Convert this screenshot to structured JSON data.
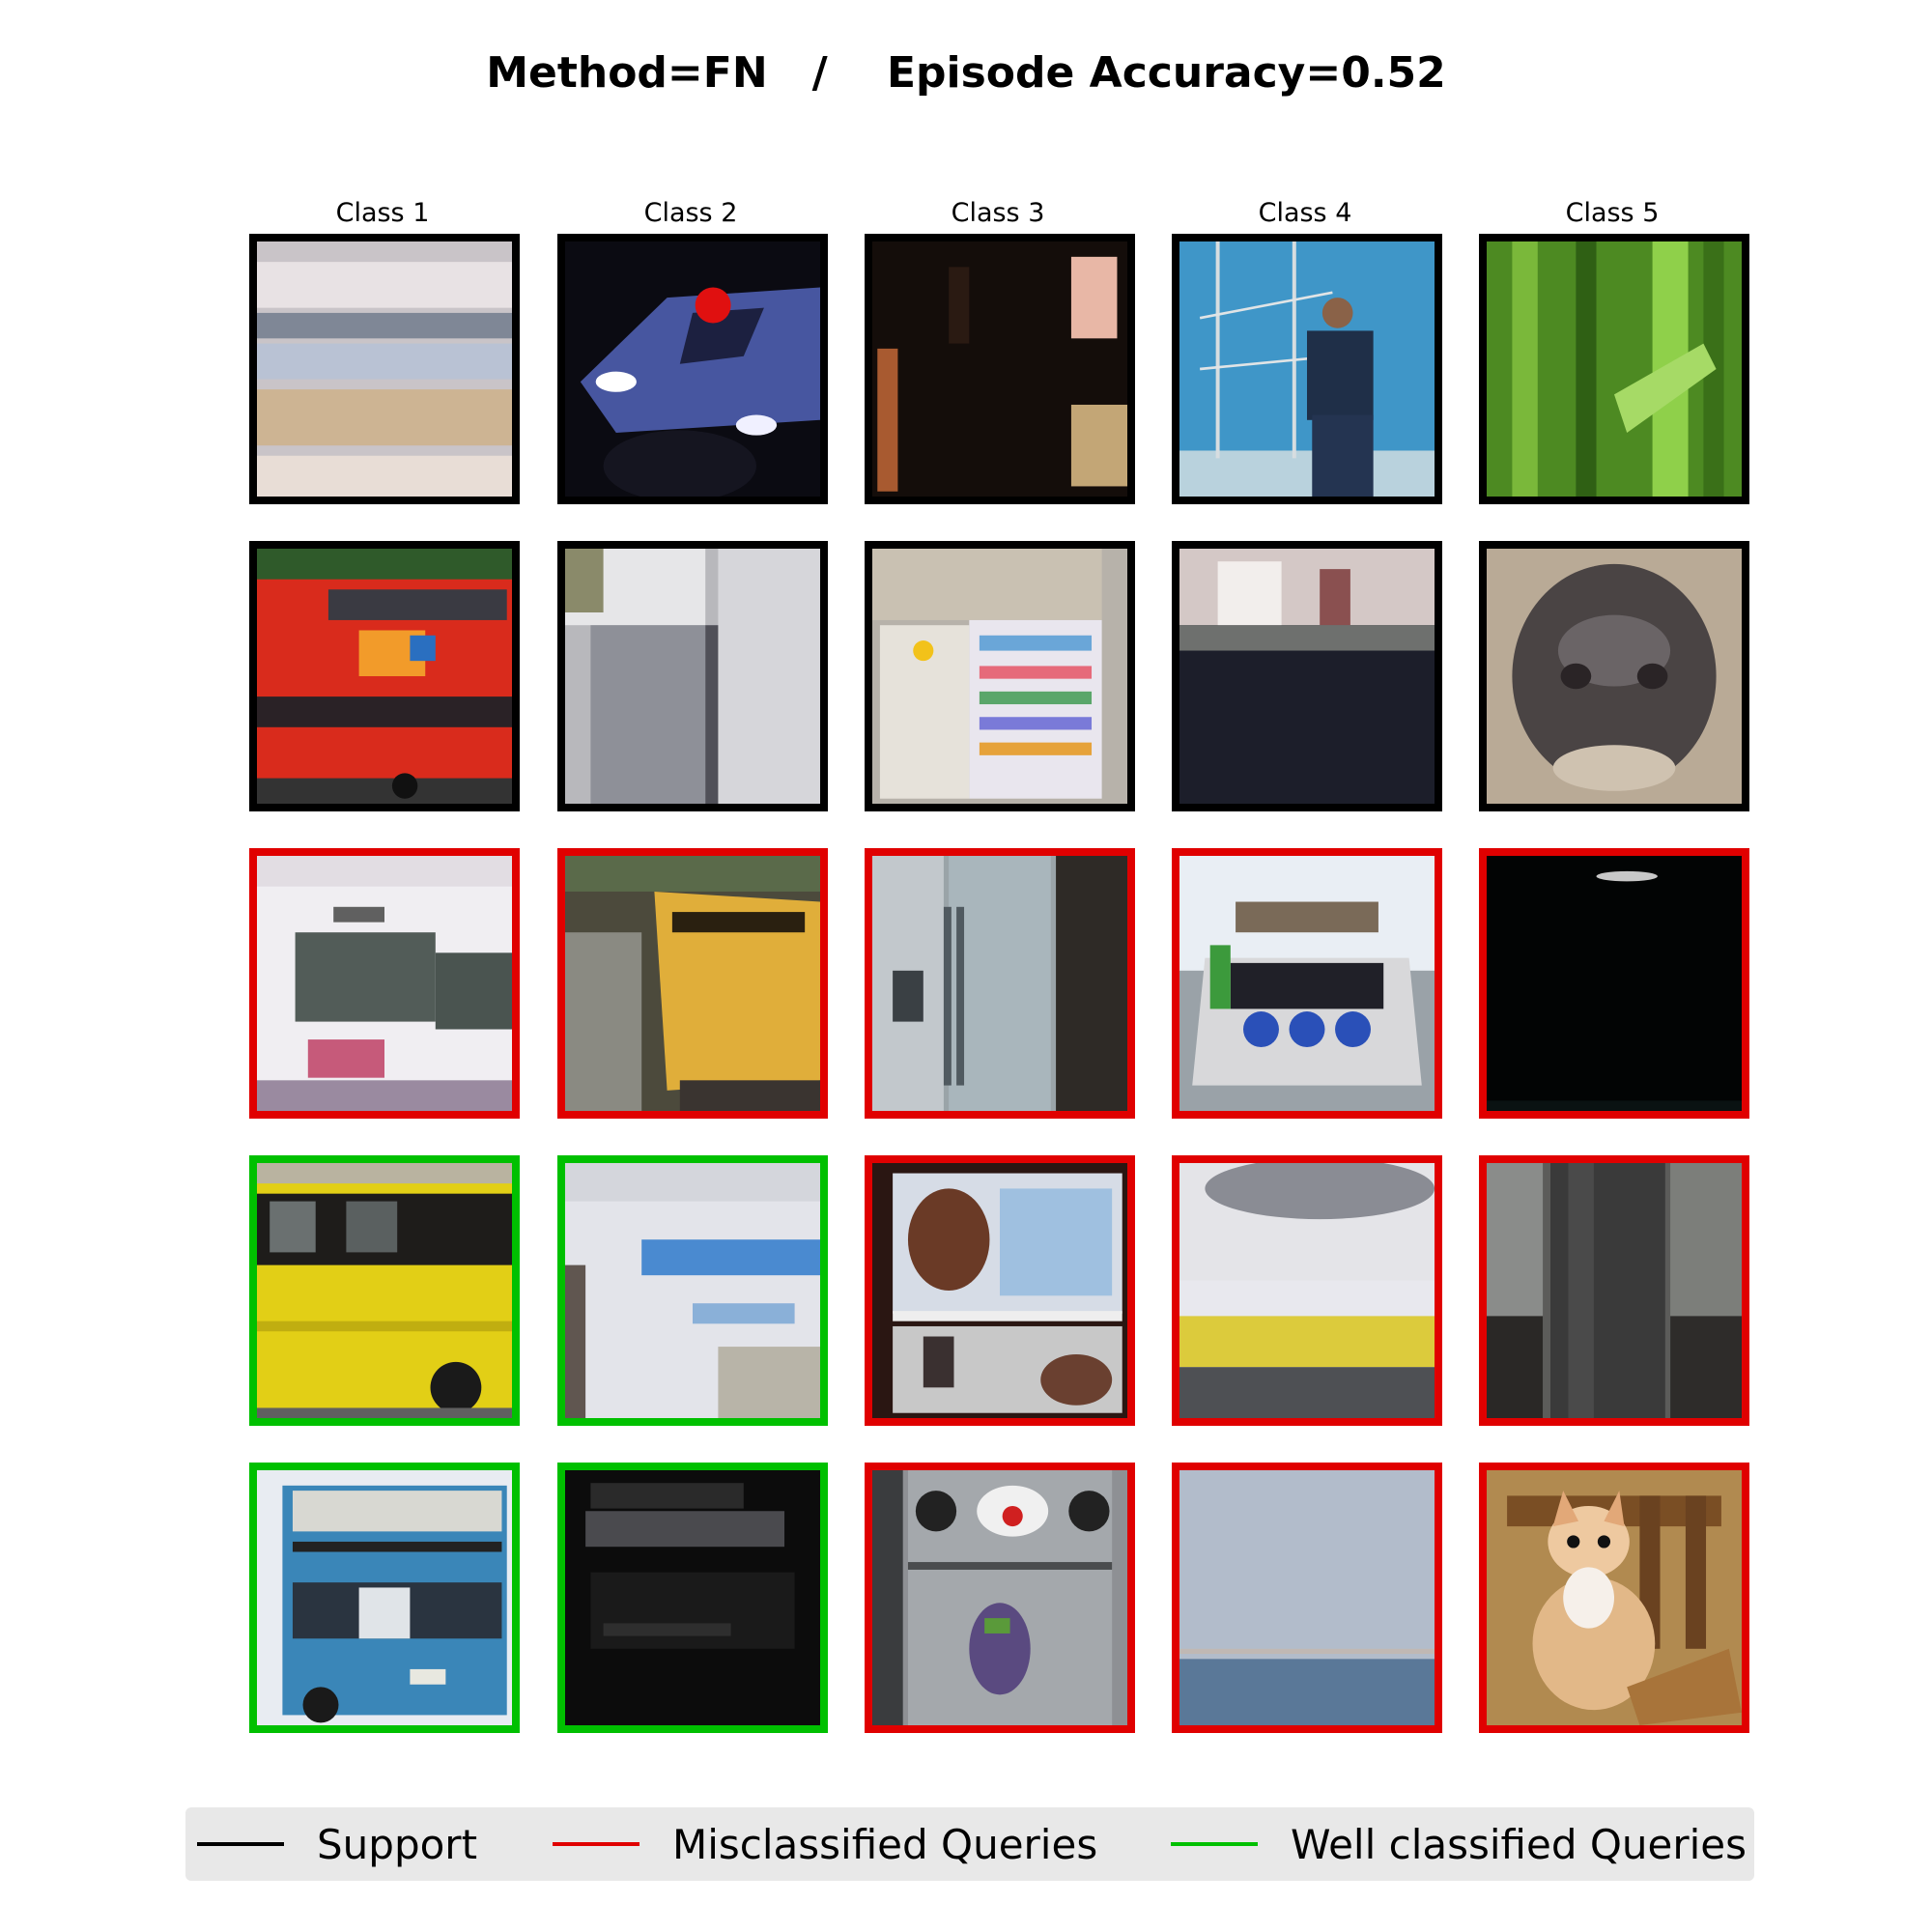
{
  "title": "Method=FN   /    Episode Accuracy=0.52",
  "columns": [
    "Class 1",
    "Class 2",
    "Class 3",
    "Class 4",
    "Class 5"
  ],
  "border_colors": {
    "support": "#000000",
    "misclassified": "#e00000",
    "well": "#00c000"
  },
  "rows": [
    {
      "role": "support",
      "cells": [
        "support",
        "support",
        "support",
        "support",
        "support"
      ],
      "images": [
        "blurry-light-scene",
        "police-van-at-night",
        "dark-interior-with-note",
        "man-in-front-of-tall-ship",
        "green-bamboo"
      ]
    },
    {
      "role": "support",
      "cells": [
        "support",
        "support",
        "support",
        "support",
        "support"
      ],
      "images": [
        "red-double-decker-bus",
        "blurry-white-truck",
        "fridge-with-papers",
        "blurry-dark-street",
        "blurry-gray-face"
      ]
    },
    {
      "role": "query",
      "cells": [
        "misclassified",
        "misclassified",
        "misclassified",
        "misclassified",
        "misclassified"
      ],
      "images": [
        "white-buses",
        "yellow-penske-truck",
        "stainless-fridge",
        "motor-boat",
        "dark-night-sky"
      ]
    },
    {
      "role": "query",
      "cells": [
        "well",
        "well",
        "misclassified",
        "misclassified",
        "misclassified"
      ],
      "images": [
        "yellow-bus",
        "white-van-truck",
        "open-fridge-with-bottles",
        "blurry-yellow-stripe",
        "dark-pillar"
      ]
    },
    {
      "role": "query",
      "cells": [
        "well",
        "well",
        "misclassified",
        "misclassified",
        "misclassified"
      ],
      "images": [
        "blue-double-decker-bus",
        "dark-vehicle",
        "fridge-with-toy-car",
        "pale-sky-and-sea",
        "orange-white-cat"
      ]
    }
  ],
  "legend": [
    {
      "label": "Support",
      "color": "#000000"
    },
    {
      "label": "Misclassified Queries",
      "color": "#e00000"
    },
    {
      "label": "Well classified Queries",
      "color": "#00c000"
    }
  ]
}
